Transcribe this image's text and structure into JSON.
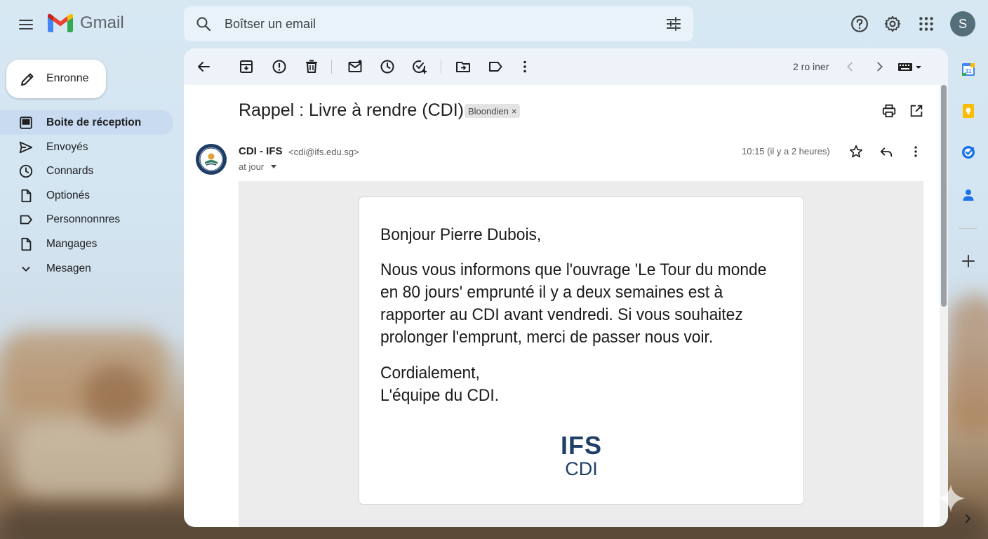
{
  "app": {
    "name": "Gmail"
  },
  "search": {
    "placeholder": "Boîtser un email"
  },
  "account": {
    "avatar_letter": "S"
  },
  "sidebar": {
    "compose_label": "Enronne",
    "items": [
      {
        "label": "Boite de réception",
        "icon": "inbox-icon",
        "active": true
      },
      {
        "label": "Envoyés",
        "icon": "send-icon"
      },
      {
        "label": "Connards",
        "icon": "clock-icon"
      },
      {
        "label": "Optionés",
        "icon": "file-icon"
      },
      {
        "label": "Personnonnres",
        "icon": "label-icon"
      },
      {
        "label": "Mangages",
        "icon": "file-icon"
      },
      {
        "label": "Mesagen",
        "icon": "chevron-down-icon"
      }
    ]
  },
  "toolbar": {
    "pager_text": "2 ro iner"
  },
  "email": {
    "subject": "Rappel : Livre à rendre (CDI)",
    "label_chip": "Bloondien",
    "label_chip_close": "×",
    "sender_name": "CDI - IFS",
    "sender_email": "<cdi@ifs.edu.sg>",
    "recipient": "at jour",
    "time": "10:15 (il y a 2 heures)",
    "greeting": "Bonjour Pierre Dubois,",
    "paragraph": "Nous vous informons que l'ouvrage 'Le Tour du monde en 80 jours' emprunté il y a deux semaines est à rapporter au CDI avant vendredi. Si vous souhaitez prolonger l'emprunt, merci de passer nous voir.",
    "closing_line1": "Cordialement,",
    "closing_line2": "L'équipe du CDI.",
    "logo_line1": "IFS",
    "logo_line2": "CDI"
  },
  "colors": {
    "gmail_red": "#ea4335",
    "gmail_blue": "#4285f4",
    "gmail_yellow": "#fbbc04",
    "gmail_green": "#34a853",
    "active_nav": "#c9dbf0",
    "logo_navy": "#1f3f68"
  }
}
